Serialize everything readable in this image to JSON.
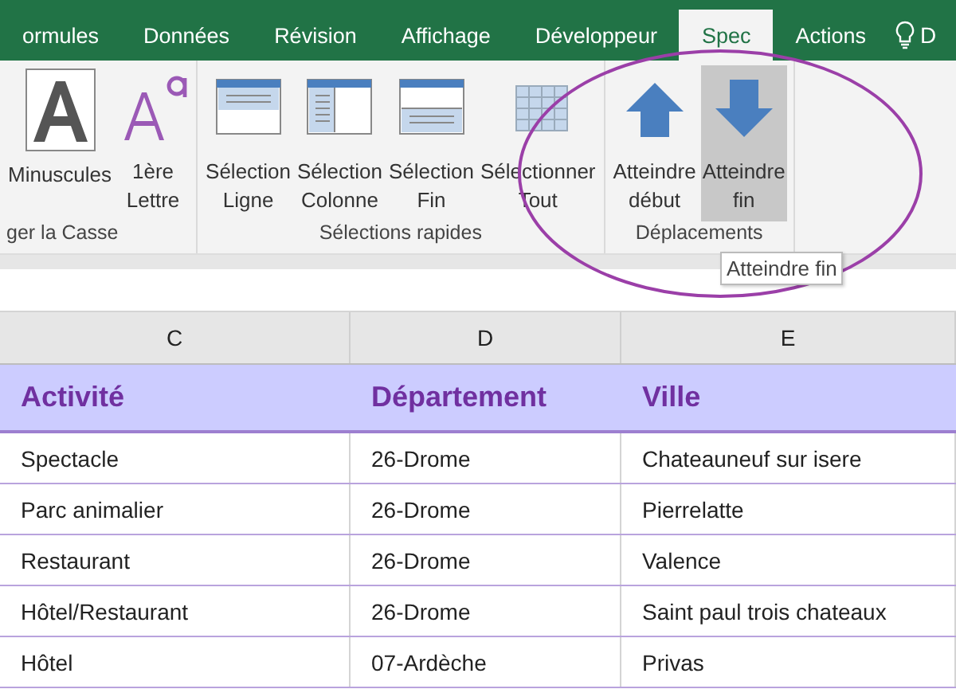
{
  "tabs": [
    {
      "label": "ormules",
      "selected": false
    },
    {
      "label": "Données",
      "selected": false
    },
    {
      "label": "Révision",
      "selected": false
    },
    {
      "label": "Affichage",
      "selected": false
    },
    {
      "label": "Développeur",
      "selected": false
    },
    {
      "label": "Spec",
      "selected": true
    },
    {
      "label": "Actions",
      "selected": false
    }
  ],
  "tell_me": {
    "text": "D"
  },
  "ribbon": {
    "groups": [
      {
        "label": "ger la Casse",
        "buttons": [
          {
            "lines": [
              "Minuscules"
            ],
            "kind": "letter-a",
            "selected": true,
            "hovered": false
          },
          {
            "lines": [
              "1ère",
              "Lettre"
            ],
            "kind": "letter-aa",
            "selected": false,
            "hovered": false
          }
        ]
      },
      {
        "label": "Sélections rapides",
        "buttons": [
          {
            "lines": [
              "Sélection",
              "Ligne"
            ],
            "kind": "sel-row",
            "selected": false,
            "hovered": false
          },
          {
            "lines": [
              "Sélection",
              "Colonne"
            ],
            "kind": "sel-col",
            "selected": false,
            "hovered": false
          },
          {
            "lines": [
              "Sélection",
              "Fin"
            ],
            "kind": "sel-end",
            "selected": false,
            "hovered": false
          },
          {
            "lines": [
              "Sélectionner",
              "Tout"
            ],
            "kind": "sel-all",
            "selected": false,
            "hovered": false
          }
        ]
      },
      {
        "label": "Déplacements",
        "buttons": [
          {
            "lines": [
              "Atteindre",
              "début"
            ],
            "kind": "arrow-up",
            "selected": false,
            "hovered": false
          },
          {
            "lines": [
              "Atteindre",
              "fin"
            ],
            "kind": "arrow-down",
            "selected": false,
            "hovered": true
          }
        ]
      }
    ]
  },
  "tooltip": {
    "text": "Atteindre fin"
  },
  "sheet": {
    "columns": [
      "C",
      "D",
      "E"
    ],
    "header": [
      "Activité",
      "Département",
      "Ville"
    ],
    "rows": [
      [
        "Spectacle",
        "26-Drome",
        "Chateauneuf sur isere"
      ],
      [
        "Parc animalier",
        "26-Drome",
        "Pierrelatte"
      ],
      [
        "Restaurant",
        "26-Drome",
        "Valence"
      ],
      [
        "Hôtel/Restaurant",
        "26-Drome",
        "Saint paul trois chateaux"
      ],
      [
        "Hôtel",
        "07-Ardèche",
        "Privas"
      ]
    ]
  }
}
